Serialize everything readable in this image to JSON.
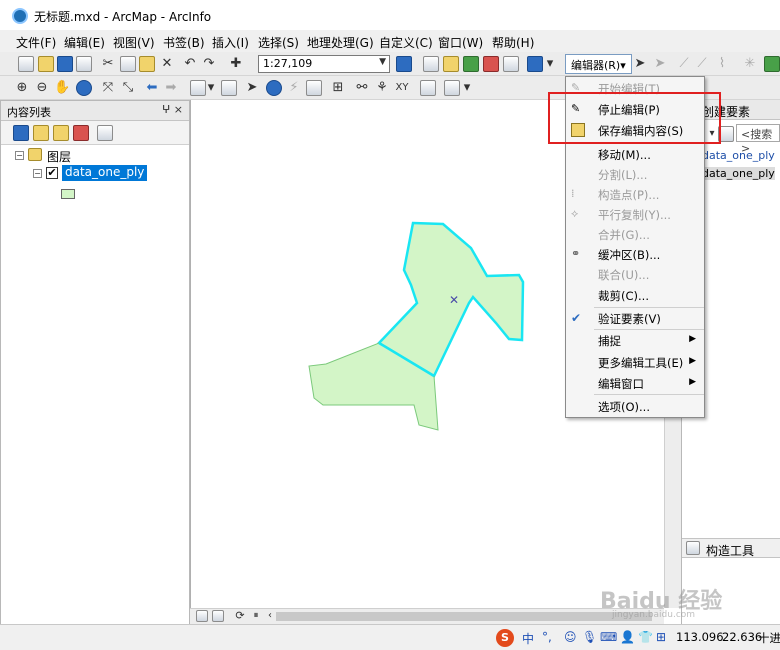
{
  "window": {
    "title": "无标题.mxd - ArcMap - ArcInfo"
  },
  "menubar": [
    "文件(F)",
    "编辑(E)",
    "视图(V)",
    "书签(B)",
    "插入(I)",
    "选择(S)",
    "地理处理(G)",
    "自定义(C)",
    "窗口(W)",
    "帮助(H)"
  ],
  "toolbar": {
    "scale_value": "1:27,109",
    "editor_button_label": "编辑器(R)▾"
  },
  "toc": {
    "title": "内容列表",
    "pin_close": "ⵖ ×",
    "group_label": "图层",
    "layer_label": "data_one_ply",
    "layer_checked": "✔"
  },
  "editor_menu": {
    "items": [
      {
        "label": "开始编辑(T)",
        "enabled": false,
        "icon": "start-edit-icon"
      },
      {
        "label": "停止编辑(P)",
        "enabled": true,
        "icon": "stop-edit-icon"
      },
      {
        "label": "保存编辑内容(S)",
        "enabled": true,
        "icon": "save-edits-icon"
      },
      {
        "label": "移动(M)...",
        "enabled": true,
        "icon": ""
      },
      {
        "label": "分割(L)...",
        "enabled": false,
        "icon": ""
      },
      {
        "label": "构造点(P)...",
        "enabled": false,
        "icon": "construct-points-icon"
      },
      {
        "label": "平行复制(Y)...",
        "enabled": false,
        "icon": "copy-parallel-icon"
      },
      {
        "label": "合并(G)...",
        "enabled": false,
        "icon": ""
      },
      {
        "label": "缓冲区(B)...",
        "enabled": true,
        "icon": "buffer-icon"
      },
      {
        "label": "联合(U)...",
        "enabled": false,
        "icon": ""
      },
      {
        "label": "裁剪(C)...",
        "enabled": true,
        "icon": ""
      },
      {
        "label": "验证要素(V)",
        "enabled": true,
        "icon": "validate-features-icon"
      },
      {
        "label": "捕捉",
        "enabled": true,
        "icon": "",
        "submenu": true
      },
      {
        "label": "更多编辑工具(E)",
        "enabled": true,
        "icon": "",
        "submenu": true
      },
      {
        "label": "编辑窗口",
        "enabled": true,
        "icon": "",
        "submenu": true
      },
      {
        "label": "选项(O)...",
        "enabled": true,
        "icon": ""
      }
    ]
  },
  "create_features": {
    "title": "创建要素",
    "search_placeholder": "<搜索>",
    "items": [
      "data_one_ply",
      "data_one_ply"
    ]
  },
  "construction_tools": {
    "title": "构造工具"
  },
  "statusbar": {
    "x": "113.096",
    "y": "22.636",
    "units": "十进",
    "ime_logo": "S",
    "ime_mode": "中"
  },
  "watermark": {
    "text": "Baidu 经验",
    "sub": "jingyan.baidu.com"
  },
  "colors": {
    "polygon_fill": "#d3f5c7",
    "polygon_outline": "#7bc97b",
    "selection_outline": "#19e6f2",
    "highlight": "#e02020",
    "selected_layer": "#0078d7"
  }
}
